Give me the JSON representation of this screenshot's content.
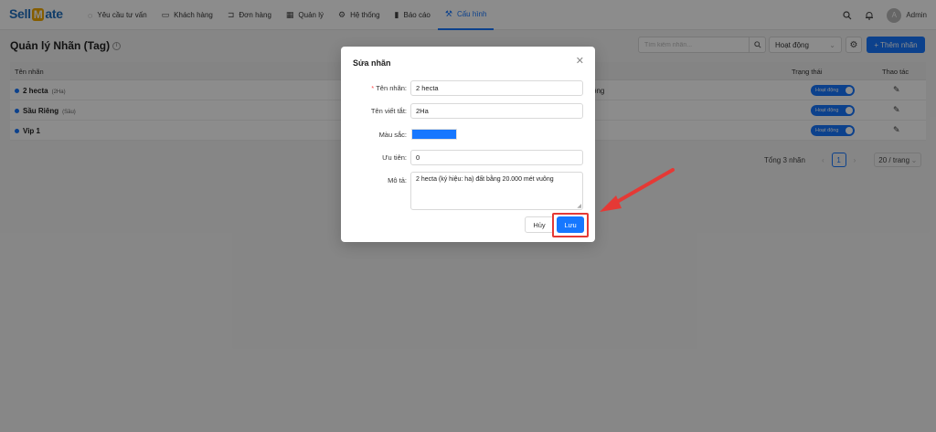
{
  "app": {
    "logo_part1": "Sell",
    "logo_part2": "M",
    "logo_part3": "ate"
  },
  "nav": {
    "items": [
      {
        "label": "Yêu cầu tư vấn",
        "icon": "chat-icon"
      },
      {
        "label": "Khách hàng",
        "icon": "contact-card-icon"
      },
      {
        "label": "Đơn hàng",
        "icon": "cart-icon"
      },
      {
        "label": "Quản lý",
        "icon": "grid-icon"
      },
      {
        "label": "Hệ thống",
        "icon": "gear-icon"
      },
      {
        "label": "Báo cáo",
        "icon": "bar-chart-icon"
      },
      {
        "label": "Cấu hình",
        "icon": "wrench-icon"
      }
    ],
    "active_index": 6,
    "user_initial": "A",
    "user_name": "Admin"
  },
  "page": {
    "title": "Quản lý Nhãn (Tag)",
    "search_placeholder": "Tìm kiếm nhãn...",
    "status_filter": "Hoạt động",
    "add_button": "+ Thêm nhãn"
  },
  "table": {
    "headers": {
      "name": "Tên nhãn",
      "status": "Trạng thái",
      "action": "Thao tác"
    },
    "rows": [
      {
        "name": "2 hecta",
        "short": "(2Ha)",
        "desc": "ông",
        "status": "Hoạt động"
      },
      {
        "name": "Sầu Riêng",
        "short": "(Sầu)",
        "desc": "",
        "status": "Hoạt động"
      },
      {
        "name": "Vip 1",
        "short": "",
        "desc": "",
        "status": "Hoạt động"
      }
    ],
    "pager": {
      "total": "Tổng 3 nhãn",
      "current": "1",
      "page_size": "20 / trang"
    }
  },
  "modal": {
    "title": "Sửa nhãn",
    "fields": {
      "name_label": "Tên nhãn:",
      "name_value": "2 hecta",
      "short_label": "Tên viết tắt:",
      "short_value": "2Ha",
      "color_label": "Màu sắc:",
      "color_value": "#1677ff",
      "priority_label": "Ưu tiên:",
      "priority_value": "0",
      "desc_label": "Mô tả:",
      "desc_value": "2 hecta (ký hiệu: ha) đất bằng 20.000 mét vuông"
    },
    "cancel_label": "Hủy",
    "save_label": "Lưu"
  },
  "colors": {
    "primary": "#1677ff",
    "highlight": "#e53935",
    "arrow": "#e53935"
  }
}
